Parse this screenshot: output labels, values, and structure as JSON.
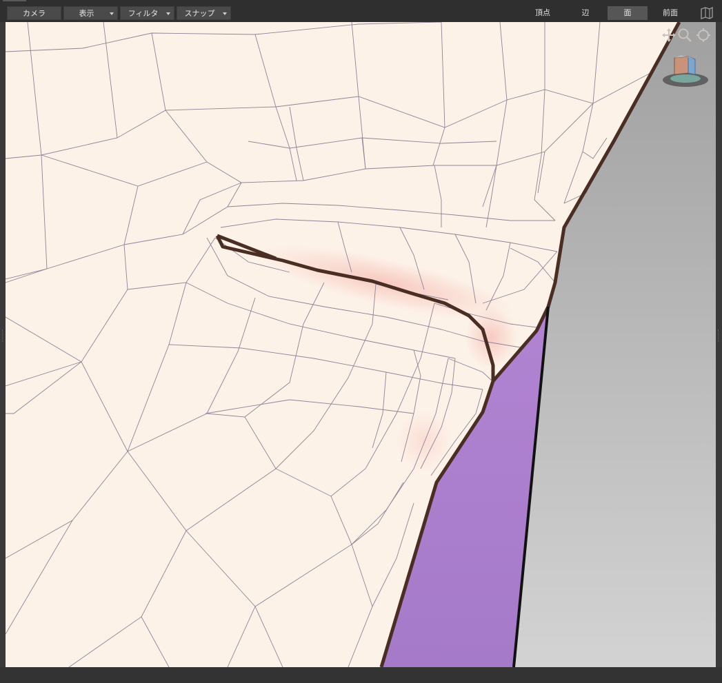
{
  "toolbar": {
    "menus": [
      {
        "label": "カメラ",
        "has_dropdown": false
      },
      {
        "label": "表示",
        "has_dropdown": true
      },
      {
        "label": "フィルタ",
        "has_dropdown": true
      },
      {
        "label": "スナップ",
        "has_dropdown": true
      }
    ],
    "modes": [
      {
        "label": "頂点",
        "active": false
      },
      {
        "label": "辺",
        "active": false
      },
      {
        "label": "面",
        "active": true
      },
      {
        "label": "前面",
        "active": false
      }
    ]
  },
  "viewport": {
    "icons": [
      "pan-icon",
      "zoom-icon",
      "rotate-icon",
      "view-cube-icon",
      "panel-toggle-icon"
    ],
    "colors": {
      "mesh": "#fdf2e8",
      "wire": "#8f8296",
      "outline": "#4a2e23",
      "selected_face": "#a87bcc",
      "background_gray_top": "#a3a3a3",
      "background_gray_bottom": "#d2d2d2"
    }
  }
}
